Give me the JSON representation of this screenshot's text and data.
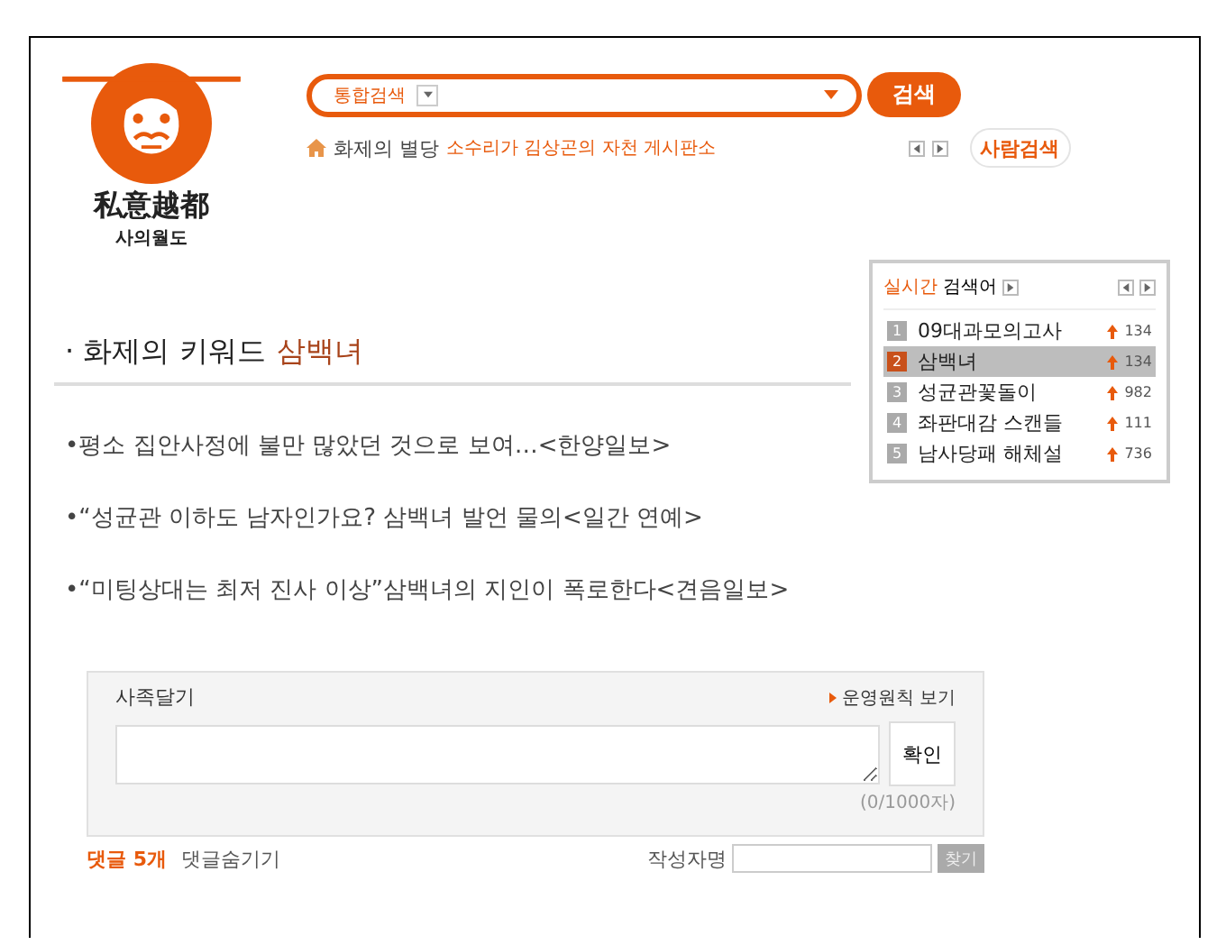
{
  "logo": {
    "hanja": "私意越都",
    "hangul": "사의월도"
  },
  "search": {
    "scope": "통합검색",
    "button": "검색"
  },
  "topic_bar": {
    "label": "화제의 별당",
    "headline": "소수리가 김상곤의 자천 게시판소"
  },
  "people_search_button": "사람검색",
  "realtime": {
    "title_highlight": "실시간",
    "title_rest": "검색어",
    "items": [
      {
        "rank": "1",
        "keyword": "09대과모의고사",
        "count": "134",
        "selected": false
      },
      {
        "rank": "2",
        "keyword": "삼백녀",
        "count": "134",
        "selected": true
      },
      {
        "rank": "3",
        "keyword": "성균관꽃돌이",
        "count": "982",
        "selected": false
      },
      {
        "rank": "4",
        "keyword": "좌판대감 스캔들",
        "count": "111",
        "selected": false
      },
      {
        "rank": "5",
        "keyword": "남사당패 해체설",
        "count": "736",
        "selected": false
      }
    ]
  },
  "keyword_heading": {
    "prefix": "· 화제의 키워드",
    "keyword": "삼백녀"
  },
  "news": [
    "•평소 집안사정에 불만 많았던 것으로 보여…<한양일보>",
    "•“성균관 이하도 남자인가요? 삼백녀 발언 물의<일간 연예>",
    "•“미팅상대는 최저 진사 이상”삼백녀의 지인이 폭로한다<견음일보>"
  ],
  "comment": {
    "label": "사족달기",
    "rules_link": "운영원칙 보기",
    "button": "확인",
    "counter": "(0/1000자)"
  },
  "footer": {
    "comment_count": "댓글 5개",
    "hide_comments": "댓글숨기기",
    "author_label": "작성자명",
    "find_button": "찾기"
  }
}
